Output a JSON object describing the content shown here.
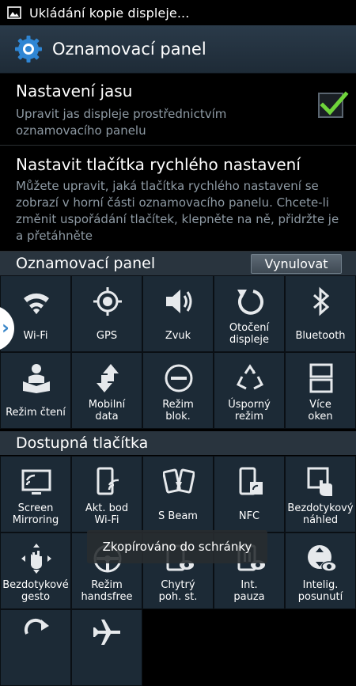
{
  "status_bar": {
    "icon": "image-icon",
    "text": "Ukládání kopie displeje..."
  },
  "action_bar": {
    "icon": "settings-gear-icon",
    "title": "Oznamovací panel"
  },
  "brightness": {
    "title": "Nastavení jasu",
    "description": "Upravit jas displeje prostřednictvím oznamovacího panelu",
    "checked": true
  },
  "quick_settings": {
    "title": "Nastavit tlačítka rychlého nastavení",
    "description": "Můžete upravit, jaká tlačítka rychlého nastavení se zobrazí v horní části oznamovacího panelu. Chcete-li změnit uspořádání tlačítek, klepněte na ně, přidržte je a přetáhněte"
  },
  "panel_section": {
    "label": "Oznamovací panel",
    "reset_label": "Vynulovat"
  },
  "panel_tiles": [
    {
      "label": "Wi-Fi",
      "icon": "wifi-icon"
    },
    {
      "label": "GPS",
      "icon": "gps-icon"
    },
    {
      "label": "Zvuk",
      "icon": "sound-icon"
    },
    {
      "label": "Otočení\ndispleje",
      "icon": "rotation-icon"
    },
    {
      "label": "Bluetooth",
      "icon": "bluetooth-icon"
    },
    {
      "label": "Režim čtení",
      "icon": "reading-mode-icon"
    },
    {
      "label": "Mobilní\ndata",
      "icon": "mobile-data-icon"
    },
    {
      "label": "Režim\nblok.",
      "icon": "blocking-mode-icon"
    },
    {
      "label": "Úsporný\nrežim",
      "icon": "power-saving-icon"
    },
    {
      "label": "Více\noken",
      "icon": "multi-window-icon"
    }
  ],
  "available_section": {
    "label": "Dostupná tlačítka"
  },
  "available_tiles": [
    {
      "label": "Screen\nMirroring",
      "icon": "screen-mirroring-icon"
    },
    {
      "label": "Akt. bod\nWi-Fi",
      "icon": "hotspot-icon"
    },
    {
      "label": "S Beam",
      "icon": "s-beam-icon"
    },
    {
      "label": "NFC",
      "icon": "nfc-icon"
    },
    {
      "label": "Bezdotykový\nnáhled",
      "icon": "air-view-icon"
    },
    {
      "label": "Bezdotykové\ngesto",
      "icon": "air-gesture-icon"
    },
    {
      "label": "Režim\nhandsfree",
      "icon": "handsfree-icon"
    },
    {
      "label": "Chytrý\npoh. st.",
      "icon": "smart-stay-icon"
    },
    {
      "label": "Int.\npauza",
      "icon": "smart-pause-icon"
    },
    {
      "label": "Intelig.\nposunutí",
      "icon": "smart-scroll-icon"
    },
    {
      "label": "",
      "icon": "sync-icon"
    },
    {
      "label": "",
      "icon": "airplane-icon"
    }
  ],
  "toast": {
    "text": "Zkopírováno do schránky"
  },
  "colors": {
    "accent": "#3a86c8",
    "check": "#6fd43a",
    "tile": "#1c2a36"
  }
}
